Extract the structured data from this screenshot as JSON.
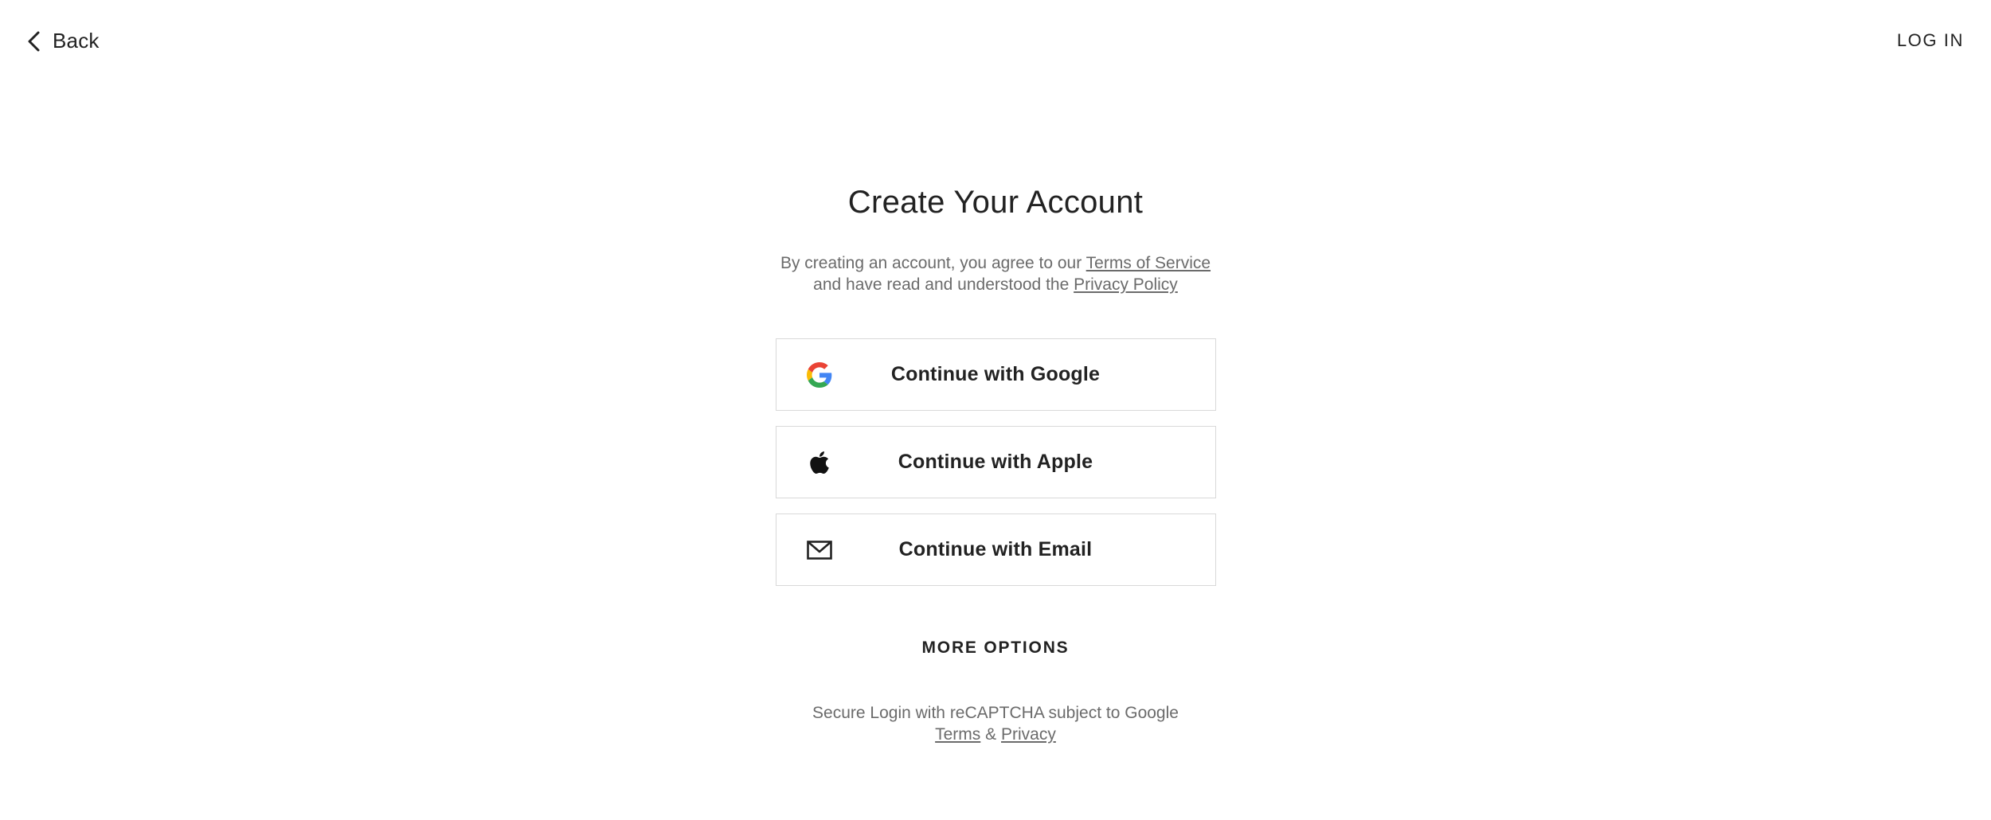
{
  "header": {
    "back_label": "Back",
    "login_label": "LOG IN"
  },
  "main": {
    "title": "Create Your Account",
    "legal": {
      "line1_prefix": "By creating an account, you agree to our",
      "terms_link": "Terms of Service",
      "line2_prefix": "and have read and understood the",
      "privacy_link": "Privacy Policy"
    },
    "buttons": {
      "google": "Continue with Google",
      "apple": "Continue with Apple",
      "email": "Continue with Email"
    },
    "more_options": "MORE OPTIONS",
    "footer": {
      "line1": "Secure Login with reCAPTCHA subject to Google",
      "terms_link": "Terms",
      "separator": "&",
      "privacy_link": "Privacy"
    }
  },
  "icons": {
    "back": "chevron-left-icon",
    "google": "google-icon",
    "apple": "apple-icon",
    "email": "envelope-icon"
  },
  "colors": {
    "text_primary": "#222222",
    "text_secondary": "#6b6b6b",
    "button_border": "#d9d9d9",
    "google_blue": "#4285F4",
    "google_red": "#EA4335",
    "google_yellow": "#FBBC05",
    "google_green": "#34A853"
  }
}
